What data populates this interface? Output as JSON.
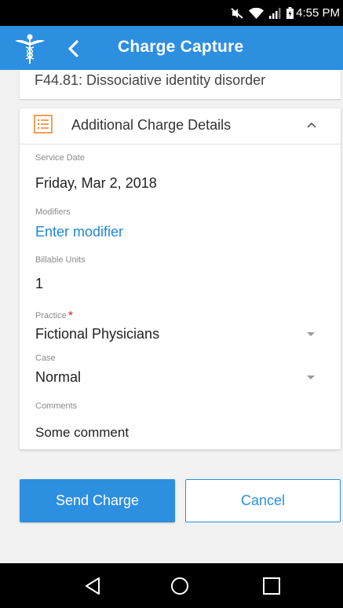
{
  "status_bar": {
    "time": "4:55 PM",
    "icons": [
      "mute-icon",
      "wifi-icon",
      "signal-icon",
      "battery-icon"
    ]
  },
  "header": {
    "title": "Charge Capture",
    "logo_icon": "caduceus-icon",
    "back_icon": "chevron-left-icon"
  },
  "diagnosis": {
    "text": "F44.81: Dissociative identity disorder"
  },
  "details": {
    "title": "Additional Charge Details",
    "icon": "list-icon",
    "toggle_icon": "chevron-up-icon",
    "service_date": {
      "label": "Service Date",
      "value": "Friday, Mar 2, 2018"
    },
    "modifiers": {
      "label": "Modifiers",
      "value": "Enter modifier"
    },
    "billable_units": {
      "label": "Billable Units",
      "value": "1"
    },
    "practice": {
      "label": "Practice",
      "required_mark": "*",
      "value": "Fictional Physicians"
    },
    "case": {
      "label": "Case",
      "value": "Normal"
    },
    "comments": {
      "label": "Comments",
      "value": "Some comment"
    }
  },
  "actions": {
    "send_label": "Send Charge",
    "cancel_label": "Cancel"
  },
  "nav": {
    "icons": [
      "back-triangle-icon",
      "home-circle-icon",
      "recents-square-icon"
    ]
  },
  "colors": {
    "accent": "#2d8fe0",
    "link": "#1e86d6",
    "required": "#e02020",
    "list_icon": "#f0892e"
  }
}
